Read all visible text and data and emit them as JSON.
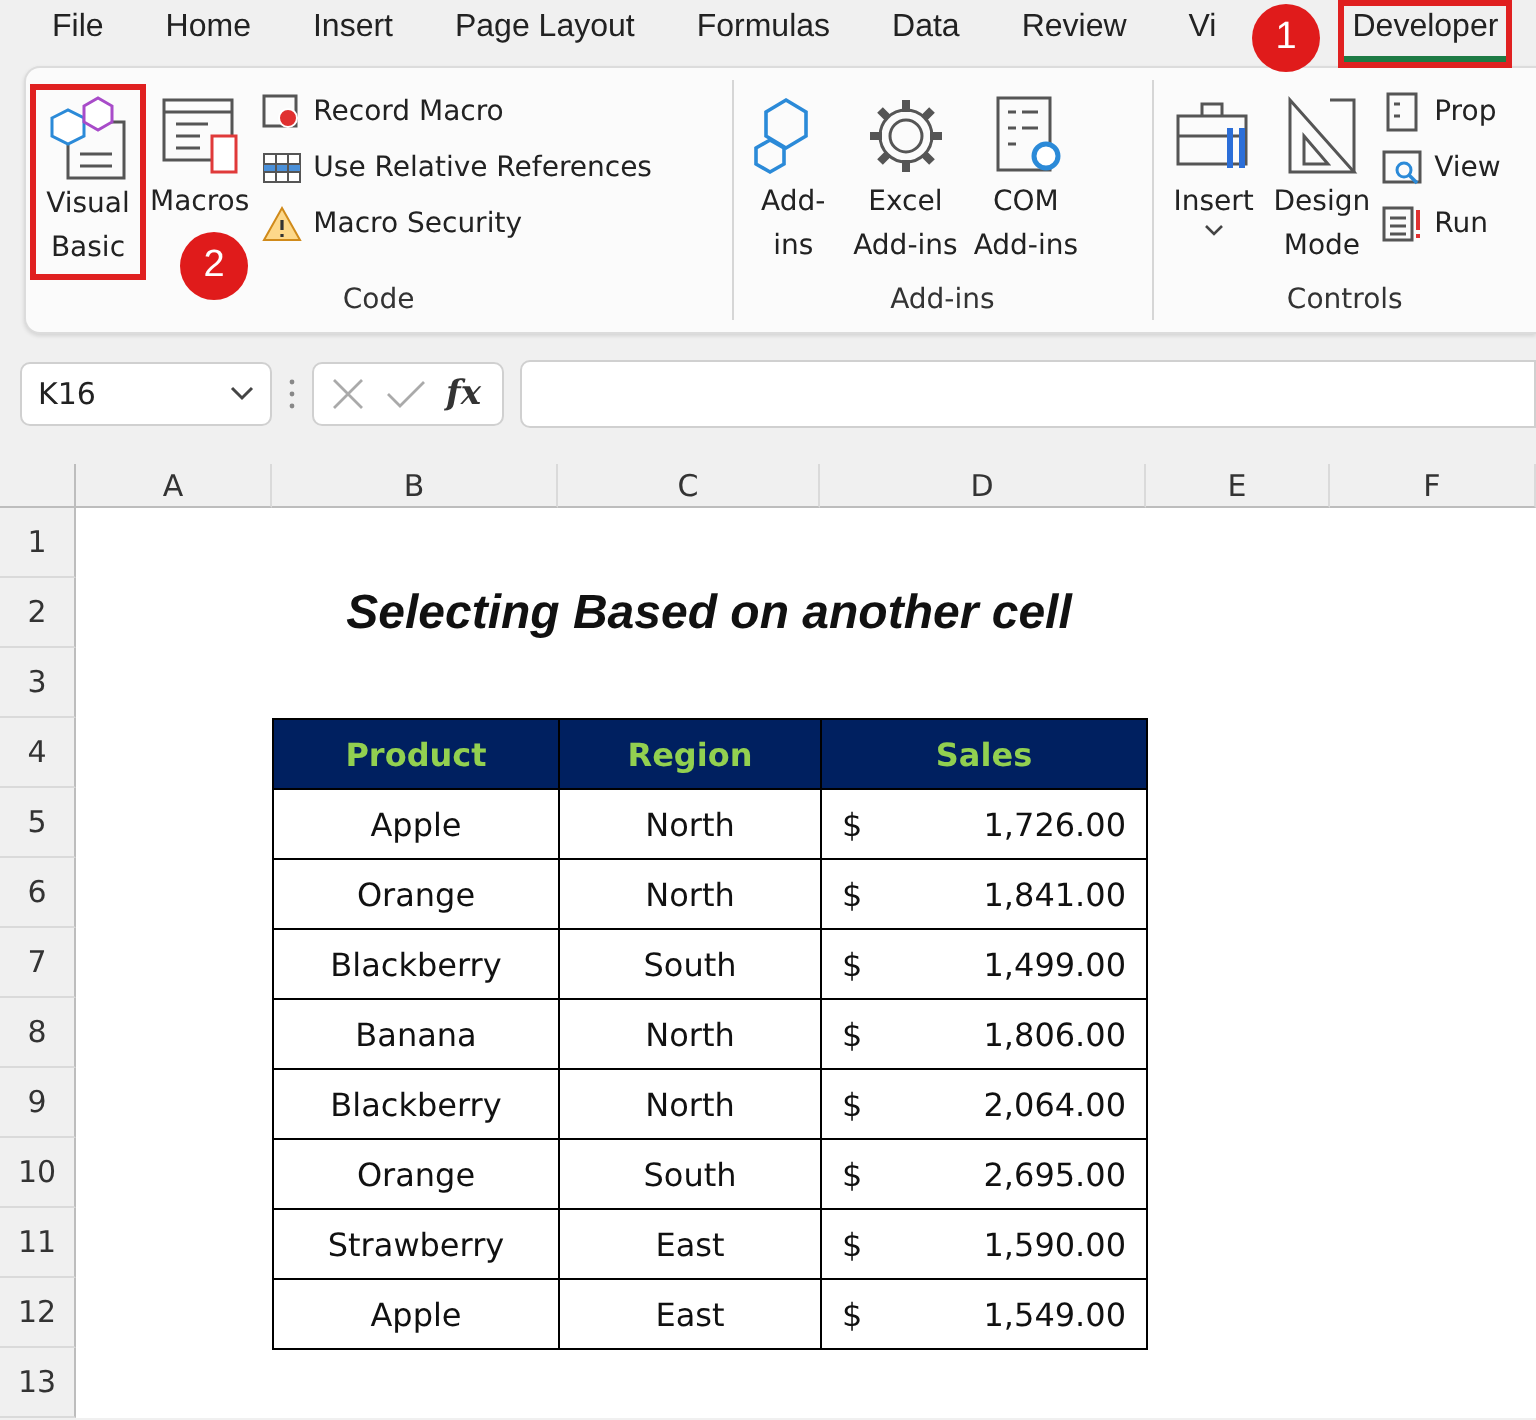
{
  "tabs": [
    {
      "label": "File",
      "selected": false
    },
    {
      "label": "Home",
      "selected": false
    },
    {
      "label": "Insert",
      "selected": false
    },
    {
      "label": "Page Layout",
      "selected": false
    },
    {
      "label": "Formulas",
      "selected": false
    },
    {
      "label": "Data",
      "selected": false
    },
    {
      "label": "Review",
      "selected": false
    },
    {
      "label": "Vi",
      "selected": false
    },
    {
      "label": "Developer",
      "selected": true
    }
  ],
  "ribbon_groups": [
    {
      "label": "Code",
      "items": [
        {
          "kind": "large",
          "lines": [
            "Visual",
            "Basic"
          ]
        },
        {
          "kind": "large",
          "lines": [
            "Macros"
          ]
        },
        {
          "kind": "stack",
          "entries": [
            "Record Macro",
            "Use Relative References",
            "Macro Security"
          ]
        }
      ]
    },
    {
      "label": "Add-ins",
      "items": [
        {
          "kind": "large",
          "lines": [
            "Add-",
            "ins"
          ]
        },
        {
          "kind": "large",
          "lines": [
            "Excel",
            "Add-ins"
          ]
        },
        {
          "kind": "large",
          "lines": [
            "COM",
            "Add-ins"
          ]
        }
      ]
    },
    {
      "label": "Controls",
      "items": [
        {
          "kind": "dropdown",
          "lines": [
            "Insert"
          ]
        },
        {
          "kind": "large",
          "lines": [
            "Design",
            "Mode"
          ]
        },
        {
          "kind": "stack",
          "entries": [
            "Prop",
            "View",
            "Run"
          ]
        }
      ]
    }
  ],
  "callouts": [
    {
      "number": "1"
    },
    {
      "number": "2"
    }
  ],
  "name_box": "K16",
  "formula_icons": [
    "fx"
  ],
  "columns": [
    "A",
    "B",
    "C",
    "D",
    "E",
    "F"
  ],
  "row_numbers": [
    "1",
    "2",
    "3",
    "4",
    "5",
    "6",
    "7",
    "8",
    "9",
    "10",
    "11",
    "12",
    "13"
  ],
  "title": "Selecting Based on another cell",
  "table": {
    "headers": [
      "Product",
      "Region",
      "Sales"
    ],
    "rows": [
      {
        "product": "Apple",
        "region": "North",
        "currency": "$",
        "amount": "1,726.00"
      },
      {
        "product": "Orange",
        "region": "North",
        "currency": "$",
        "amount": "1,841.00"
      },
      {
        "product": "Blackberry",
        "region": "South",
        "currency": "$",
        "amount": "1,499.00"
      },
      {
        "product": "Banana",
        "region": "North",
        "currency": "$",
        "amount": "1,806.00"
      },
      {
        "product": "Blackberry",
        "region": "North",
        "currency": "$",
        "amount": "2,064.00"
      },
      {
        "product": "Orange",
        "region": "South",
        "currency": "$",
        "amount": "2,695.00"
      },
      {
        "product": "Strawberry",
        "region": "East",
        "currency": "$",
        "amount": "1,590.00"
      },
      {
        "product": "Apple",
        "region": "East",
        "currency": "$",
        "amount": "1,549.00"
      }
    ]
  }
}
